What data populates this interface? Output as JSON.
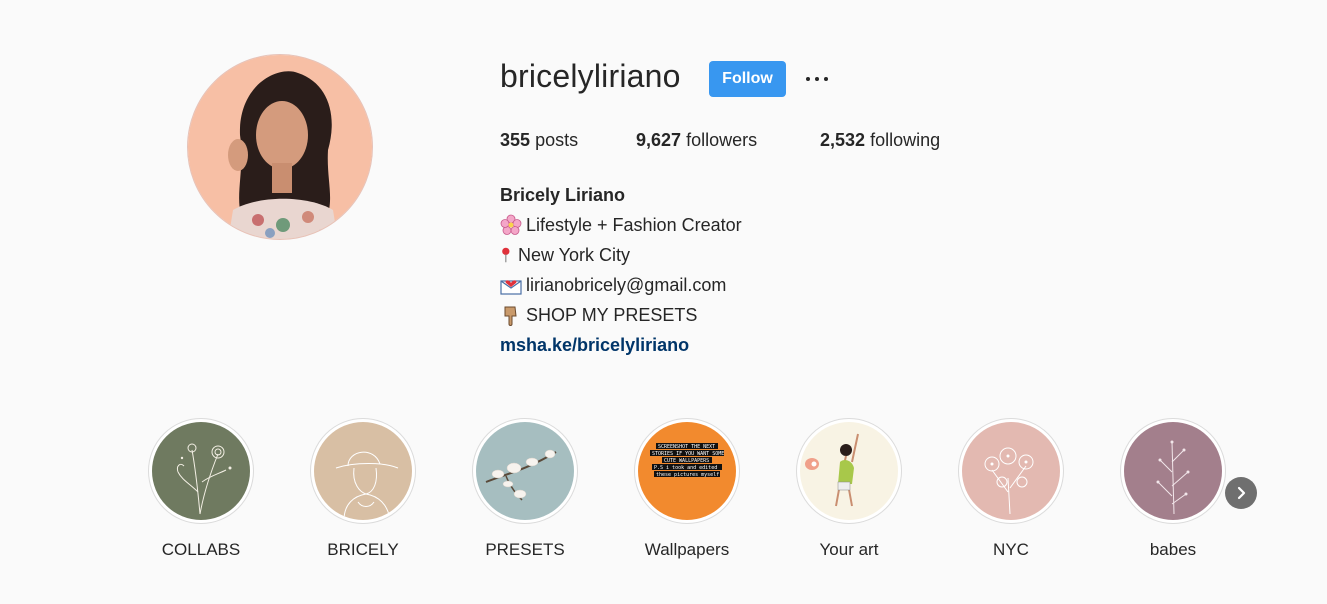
{
  "profile": {
    "username": "bricelyliriano",
    "follow_label": "Follow",
    "more_label": "…"
  },
  "stats": {
    "posts_count": "355",
    "posts_label": "posts",
    "followers_count": "9,627",
    "followers_label": "followers",
    "following_count": "2,532",
    "following_label": "following"
  },
  "bio": {
    "full_name": "Bricely Liriano",
    "line1": "Lifestyle + Fashion Creator",
    "line2": "New York City",
    "line3": "lirianobricely@gmail.com",
    "line4": "SHOP MY PRESETS",
    "link": "msha.ke/bricelyliriano"
  },
  "highlights": [
    {
      "label": "COLLABS",
      "color": "#6f7a60"
    },
    {
      "label": "BRICELY",
      "color": "#d8bfa4"
    },
    {
      "label": "PRESETS",
      "color": "#a6bec0"
    },
    {
      "label": "Wallpapers",
      "color": "#f28a2e",
      "overlay_text": [
        "SCREENSHOT THE NEXT",
        "STORIES IF YOU WANT SOME",
        "CUTE WALLPAPERS",
        "P.S i took and edited",
        "these pictures myself"
      ]
    },
    {
      "label": "Your art",
      "color": "#f8f3e4"
    },
    {
      "label": "NYC",
      "color": "#e3b9b1"
    },
    {
      "label": "babes",
      "color": "#a37f8c"
    }
  ],
  "icons": {
    "emoji1": "cherry-blossom-icon",
    "emoji2": "round-pushpin-icon",
    "emoji3": "envelope-with-heart-icon",
    "emoji4": "pointing-down-icon",
    "next": "chevron-right-icon"
  },
  "colors": {
    "follow_button": "#3897f0",
    "link": "#003569",
    "background": "#fafafa"
  }
}
